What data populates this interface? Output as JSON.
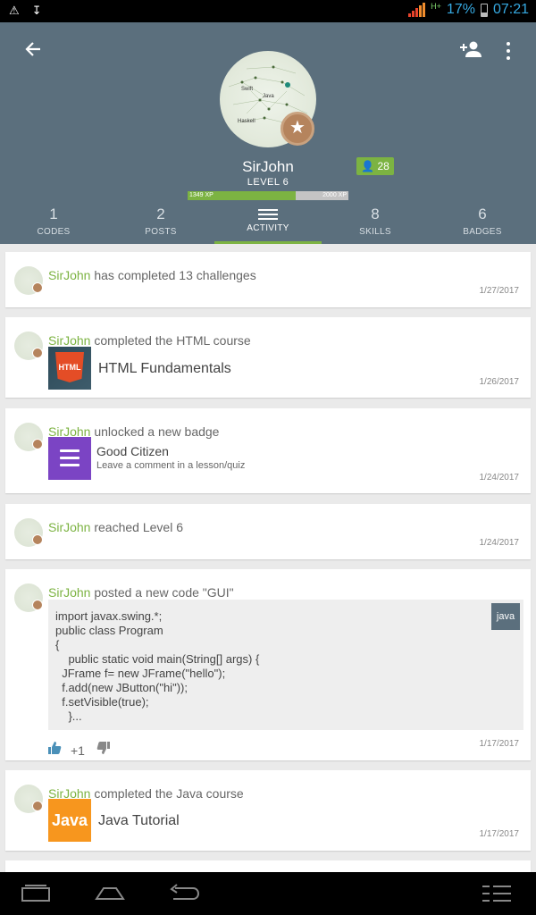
{
  "status": {
    "network": "H+",
    "battery_pct": "17%",
    "time": "07:21"
  },
  "profile": {
    "username": "SirJohn",
    "level": "LEVEL 6",
    "followers": "28",
    "xp_current": "1349 XP",
    "xp_max": "2000 XP",
    "xp_fraction": 0.6745
  },
  "tabs": [
    {
      "count": "1",
      "label": "CODES"
    },
    {
      "count": "2",
      "label": "POSTS"
    },
    {
      "count": "",
      "label": "ACTIVITY"
    },
    {
      "count": "8",
      "label": "SKILLS"
    },
    {
      "count": "6",
      "label": "BADGES"
    }
  ],
  "feed": [
    {
      "user": "SirJohn",
      "text": " has completed 13 challenges",
      "date": "1/27/2017"
    },
    {
      "user": "SirJohn",
      "text": " completed the HTML course",
      "item": "HTML Fundamentals",
      "thumb_text": "HTML",
      "date": "1/26/2017"
    },
    {
      "user": "SirJohn",
      "text": " unlocked a new badge",
      "badge_name": "Good Citizen",
      "badge_desc": "Leave a comment in a lesson/quiz",
      "date": "1/24/2017"
    },
    {
      "user": "SirJohn",
      "text": " reached Level 6",
      "date": "1/24/2017"
    },
    {
      "user": "SirJohn",
      "text": " posted a new code \"GUI\"",
      "lang": "java",
      "code": "import javax.swing.*;\npublic class Program\n{\n    public static void main(String[] args) {\n  JFrame f= new JFrame(\"hello\");\n  f.add(new JButton(\"hi\"));\n  f.setVisible(true);\n    }...",
      "votes": "+1",
      "date": "1/17/2017"
    },
    {
      "user": "SirJohn",
      "text": " completed the Java course",
      "item": "Java Tutorial",
      "thumb_text": "Java",
      "date": "1/17/2017"
    }
  ],
  "colors": {
    "header": "#5b6f7d",
    "accent": "#7cb342",
    "badge_purple": "#7b44c4",
    "java_orange": "#f7961e"
  }
}
